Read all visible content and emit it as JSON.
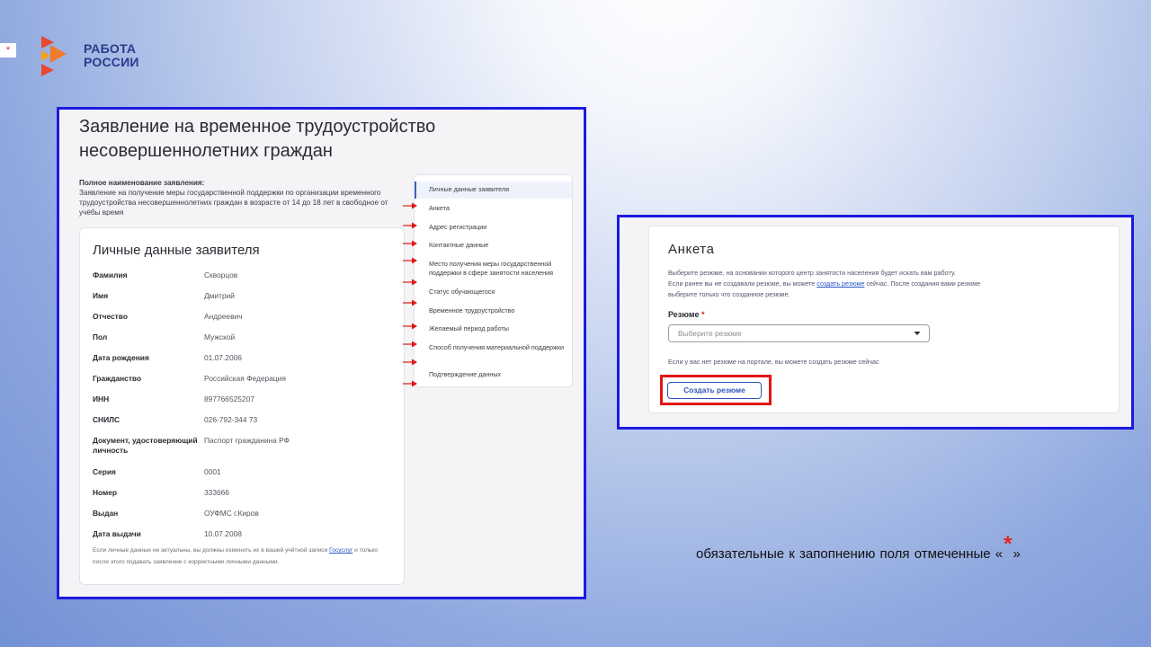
{
  "slide": {
    "corner_mark": "*",
    "logo": {
      "line1": "РАБОТА",
      "line2": "РОССИИ",
      "colors": [
        "#e8482f",
        "#ef7b2c",
        "#f4a21c",
        "#2a3a8c"
      ]
    },
    "footnote": {
      "before": "обязательные к запопнению  поля  отмеченные «",
      "star": "*",
      "after": "»"
    }
  },
  "form": {
    "title_line1": "Заявление на временное трудоустройство",
    "title_line2": "несовершеннолетних граждан",
    "fullname_label": "Полное наименование заявления:",
    "fullname_text": "Заявление на получение меры государственной поддержки по организации временного трудоустройства несовершеннолетних граждан в возрасте от 14 до 18 лет в свободное от учёбы время",
    "personal": {
      "title": "Личные данные заявителя",
      "fields": [
        {
          "label": "Фамилия",
          "value": "Скворцов"
        },
        {
          "label": "Имя",
          "value": "Дмитрий"
        },
        {
          "label": "Отчество",
          "value": "Андреевич"
        },
        {
          "label": "Пол",
          "value": "Мужской"
        },
        {
          "label": "Дата рождения",
          "value": "01.07.2006"
        },
        {
          "label": "Гражданство",
          "value": "Российская Федерация"
        },
        {
          "label": "ИНН",
          "value": "897766525207"
        },
        {
          "label": "СНИЛС",
          "value": "026-792-344 73"
        },
        {
          "label": "Документ, удостоверяющий личность",
          "value": "Паспорт гражданина РФ"
        },
        {
          "label": "Серия",
          "value": "0001"
        },
        {
          "label": "Номер",
          "value": "333666"
        },
        {
          "label": "Выдан",
          "value": "ОУФМС г.Киров"
        },
        {
          "label": "Дата выдачи",
          "value": "10.07.2008"
        }
      ],
      "note_before": "Если личные данные не актуальны, вы должны изменить их в вашей учётной записи ",
      "note_link": "Госуслуг",
      "note_after": " и только после этого подавать заявление с корректными личными данными."
    },
    "nav": [
      "Личные данные заявителя",
      "Анкета",
      "Адрес регистрации",
      "Контактные данные",
      "Место получения меры государственной поддержки в сфере занятости населения",
      "Статус обучающегося",
      "Временное трудоустройство",
      "Желаемый период работы",
      "Способ получения материальной поддержки",
      "Подтверждение данных"
    ]
  },
  "anketa": {
    "title": "Анкета",
    "desc_line1": "Выберите резюме, на основании которого центр занятости населения будет искать вам работу.",
    "desc_line2_before": "Если ранее вы не создавали резюме, вы можете ",
    "desc_link": "создать резюме",
    "desc_line2_after": " сейчас. После создания вами резюме",
    "desc_line3": "выберите только что созданное резюме.",
    "resume_label": "Резюме",
    "required_mark": "*",
    "select_placeholder": "Выберите резюме",
    "noresume_text": "Если у вас нет резюме на портале, вы можете создать резюме сейчас",
    "create_button": "Создать резюме"
  }
}
